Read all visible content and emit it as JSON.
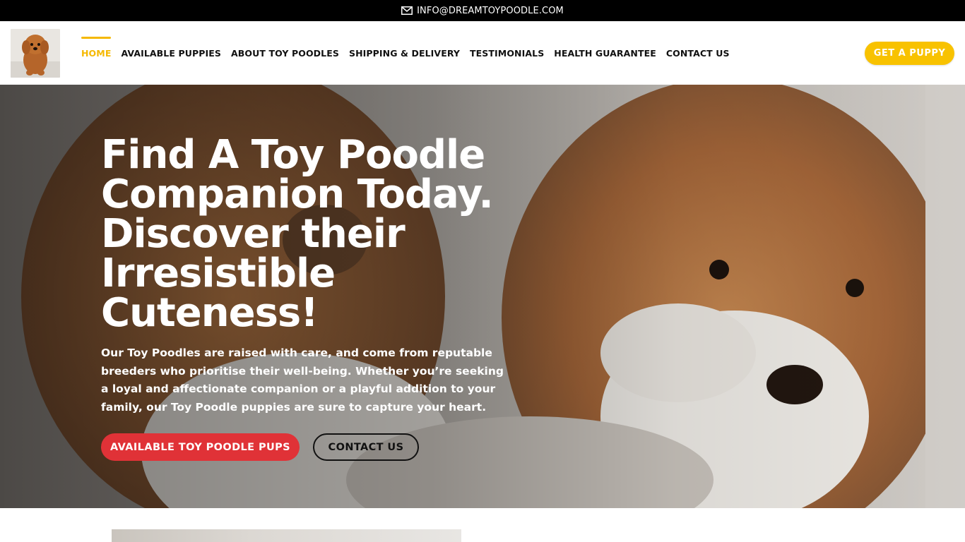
{
  "topbar": {
    "email": "INFO@DREAMTOYPOODLE.COM",
    "icon": "mail-icon"
  },
  "header": {
    "logo_icon": "poodle-logo",
    "nav": [
      {
        "label": "HOME",
        "active": true
      },
      {
        "label": "AVAILABLE PUPPIES",
        "active": false
      },
      {
        "label": "ABOUT TOY POODLES",
        "active": false
      },
      {
        "label": "SHIPPING & DELIVERY",
        "active": false
      },
      {
        "label": "TESTIMONIALS",
        "active": false
      },
      {
        "label": "HEALTH GUARANTEE",
        "active": false
      },
      {
        "label": "CONTACT US",
        "active": false
      }
    ],
    "cta_label": "GET A PUPPY"
  },
  "hero": {
    "title": "Find A Toy Poodle Companion Today. Discover their Irresistible Cuteness!",
    "text": "Our Toy Poodles  are raised with care, and come from reputable breeders who prioritise their well-being. Whether you’re seeking a loyal and affectionate companion or a playful addition to your family, our Toy Poodle puppies are sure to capture your heart.",
    "primary_button": "AVAILABLE TOY POODLE PUPS",
    "secondary_button": "CONTACT US",
    "background_image": "toy-poodle-puppies-photo"
  },
  "colors": {
    "accent_yellow": "#f8c200",
    "primary_red": "#e03237",
    "topbar_black": "#000000",
    "hero_text": "#ffffff"
  }
}
